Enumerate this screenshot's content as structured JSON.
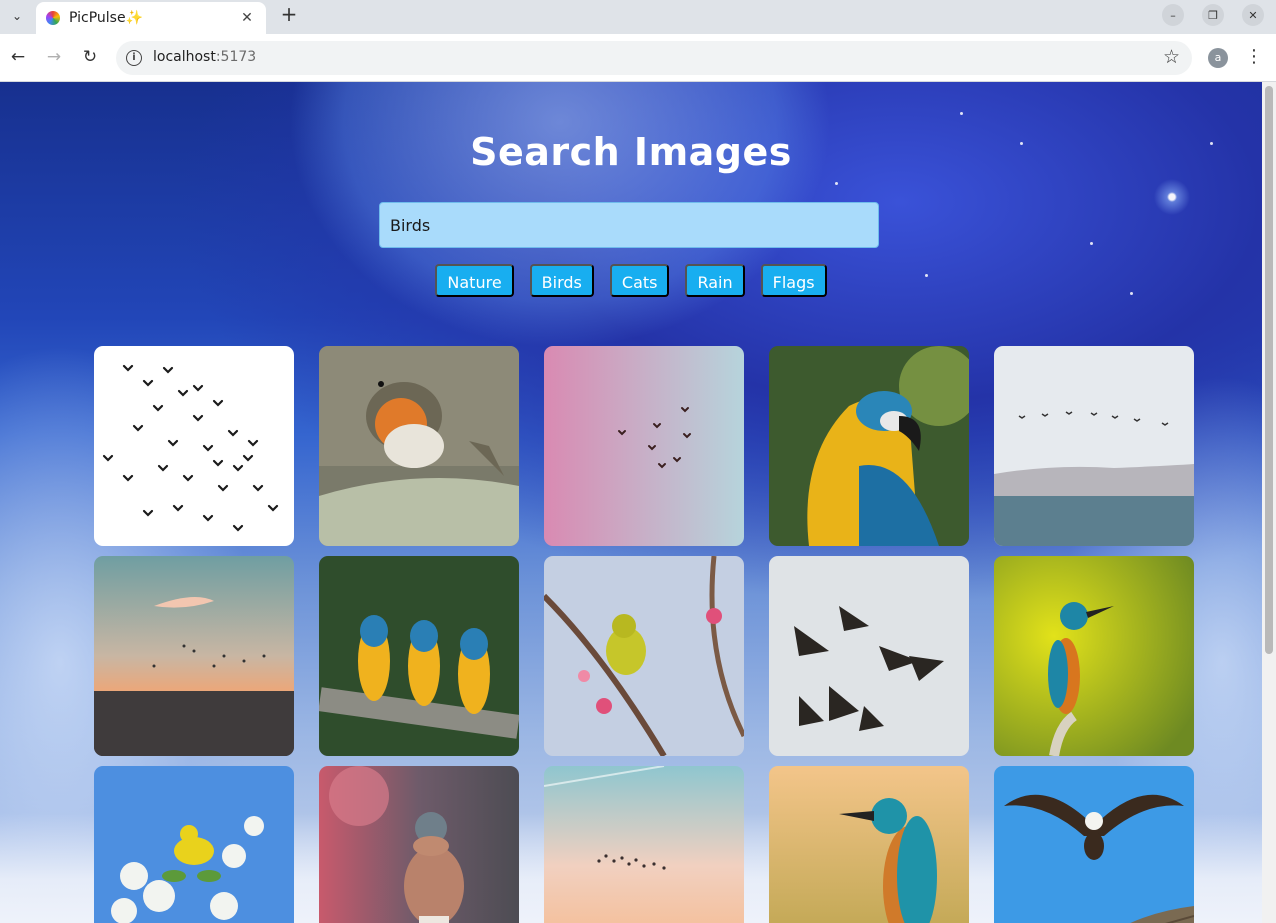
{
  "browser": {
    "tab_title": "PicPulse✨",
    "url_host": "localhost",
    "url_port": ":5173",
    "profile_initial": "a"
  },
  "app": {
    "heading": "Search Images",
    "search_value": "Birds",
    "categories": [
      "Nature",
      "Birds",
      "Cats",
      "Rain",
      "Flags"
    ]
  },
  "images": [
    {
      "subject": "bird-flock-silhouettes"
    },
    {
      "subject": "robin-on-branch"
    },
    {
      "subject": "birds-on-pastel-sky"
    },
    {
      "subject": "macaw-parrot"
    },
    {
      "subject": "birds-over-sea"
    },
    {
      "subject": "birds-at-sunset"
    },
    {
      "subject": "three-macaws"
    },
    {
      "subject": "white-eye-on-blossom"
    },
    {
      "subject": "flying-geese"
    },
    {
      "subject": "kingfisher-yellow"
    },
    {
      "subject": "yellow-warbler-blossom"
    },
    {
      "subject": "chaffinch"
    },
    {
      "subject": "birds-pastel-clouds"
    },
    {
      "subject": "kingfisher-portrait"
    },
    {
      "subject": "eagle-over-nest"
    }
  ],
  "colors": {
    "chip": "#18aef0",
    "search_bg": "#a9dbfb"
  }
}
